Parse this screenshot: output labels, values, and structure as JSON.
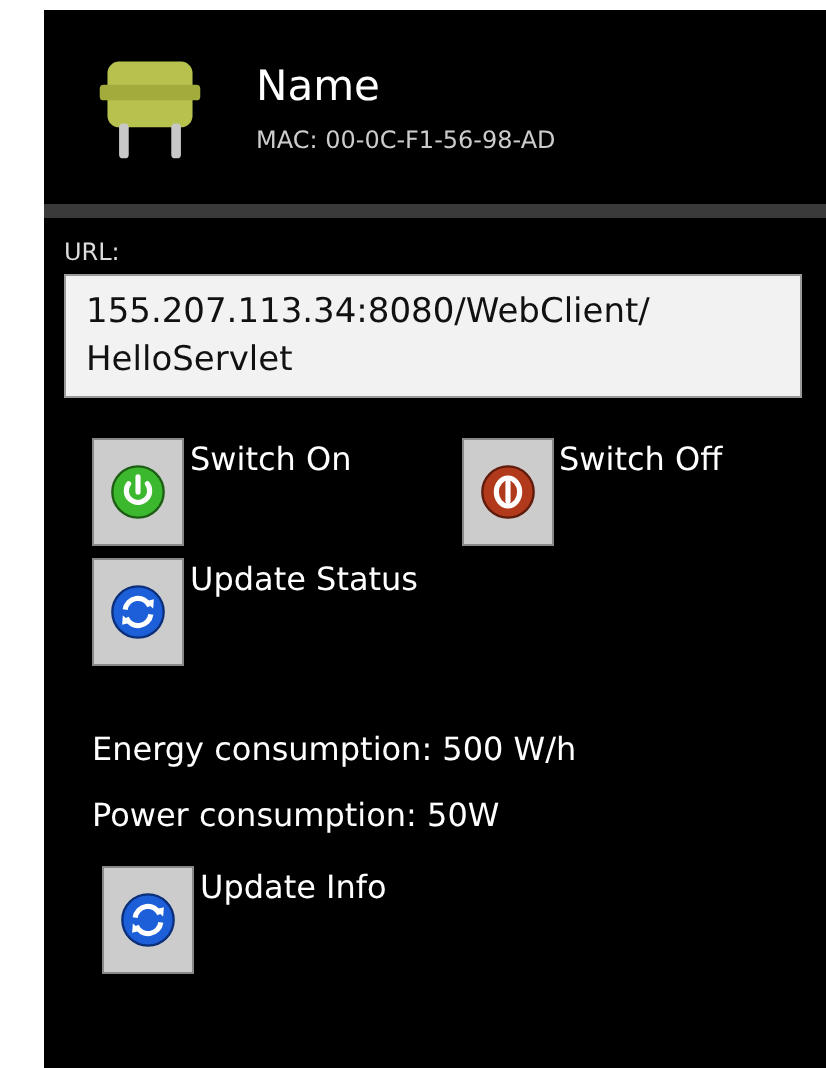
{
  "device": {
    "name": "Name",
    "mac": "MAC: 00-0C-F1-56-98-AD"
  },
  "url": {
    "label": "URL:",
    "value": "155.207.113.34:8080/WebClient/\nHelloServlet"
  },
  "switch_buttons": [
    {
      "kind": "on",
      "label": "Switch On"
    },
    {
      "kind": "off",
      "label": "Switch Off"
    }
  ],
  "status_button": {
    "kind": "refresh",
    "label": "Update Status"
  },
  "info": [
    "Energy consumption: 500 W/h",
    "Power consumption: 50W"
  ],
  "info_button": {
    "kind": "refresh",
    "label": "Update Info"
  }
}
